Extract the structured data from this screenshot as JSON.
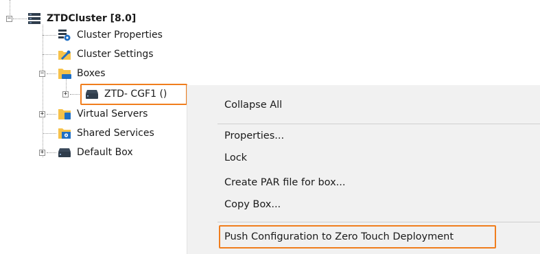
{
  "tree": {
    "root": {
      "label": "ZTDCluster [8.0]"
    },
    "children": [
      {
        "label": "Cluster Properties"
      },
      {
        "label": "Cluster Settings"
      },
      {
        "label": "Boxes"
      },
      {
        "label": "ZTD- CGF1 ()"
      },
      {
        "label": "Virtual Servers"
      },
      {
        "label": "Shared Services"
      },
      {
        "label": "Default Box"
      }
    ]
  },
  "context_menu": {
    "items": [
      "Collapse All",
      "Properties...",
      "Lock",
      "Create PAR file for box...",
      "Copy Box...",
      "Push Configuration to Zero Touch Deployment"
    ]
  },
  "colors": {
    "highlight": "#f07d1c",
    "menu_background": "#f1f1f1",
    "icon_blue": "#1f6fc5",
    "icon_dark": "#2f3d4c",
    "folder_yellow": "#f6c24a"
  }
}
